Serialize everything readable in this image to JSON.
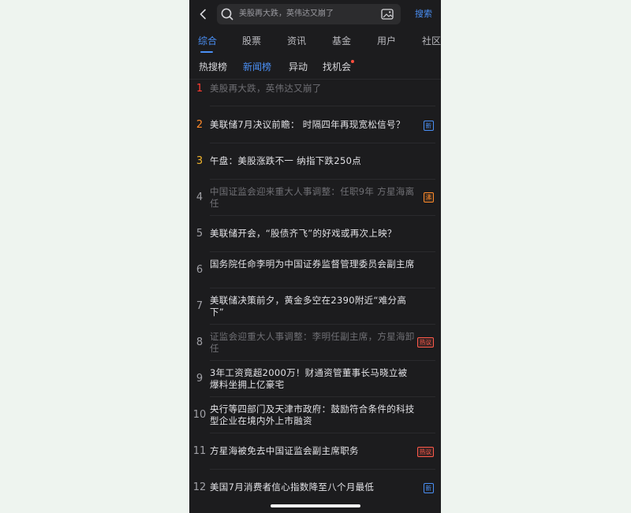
{
  "search": {
    "query": "美股再大跌，英伟达又崩了",
    "button_label": "搜索"
  },
  "icons": {
    "back": "chevron-left-icon",
    "search": "search-icon",
    "image_search": "image-search-icon"
  },
  "main_tabs": [
    {
      "label": "综合",
      "active": true
    },
    {
      "label": "股票",
      "active": false
    },
    {
      "label": "资讯",
      "active": false
    },
    {
      "label": "基金",
      "active": false
    },
    {
      "label": "用户",
      "active": false
    },
    {
      "label": "社区",
      "active": false
    }
  ],
  "sub_tabs": [
    {
      "label": "热搜榜",
      "active": false
    },
    {
      "label": "新闻榜",
      "active": true
    },
    {
      "label": "异动",
      "active": false
    },
    {
      "label": "找机会",
      "active": false,
      "dot": true
    }
  ],
  "colors": {
    "accent": "#4a8ff5",
    "rank1": "#ff3b30",
    "rank2": "#ff8a2a",
    "rank3": "#f2b52c",
    "badge_hot": "#ff5a4a",
    "badge_boil": "#ff8a2a",
    "background": "#1c1c1e"
  },
  "news": [
    {
      "rank": "1",
      "title": "美股再大跌，英伟达又崩了",
      "read": true,
      "badge": ""
    },
    {
      "rank": "2",
      "title": "美联储7月决议前瞻： 时隔四年再现宽松信号？",
      "read": false,
      "badge": "新"
    },
    {
      "rank": "3",
      "title": "午盘：美股涨跌不一 纳指下跌250点",
      "read": false,
      "badge": ""
    },
    {
      "rank": "4",
      "title": "中国证监会迎来重大人事调整：任职9年 方星海离任",
      "read": true,
      "badge": "沸"
    },
    {
      "rank": "5",
      "title": "美联储开会，“股债齐飞”的好戏或再次上映？",
      "read": false,
      "badge": ""
    },
    {
      "rank": "6",
      "title": "国务院任命李明为中国证券监督管理委员会副主席",
      "read": false,
      "badge": ""
    },
    {
      "rank": "7",
      "title": "美联储决策前夕，黄金多空在2390附近“难分高下”",
      "read": false,
      "badge": ""
    },
    {
      "rank": "8",
      "title": "证监会迎重大人事调整：李明任副主席，方星海卸任",
      "read": true,
      "badge": "热议"
    },
    {
      "rank": "9",
      "title": "3年工资竟超2000万！财通资管董事长马晓立被爆料坐拥上亿豪宅",
      "read": false,
      "badge": ""
    },
    {
      "rank": "10",
      "title": "央行等四部门及天津市政府：鼓励符合条件的科技型企业在境内外上市融资",
      "read": false,
      "badge": ""
    },
    {
      "rank": "11",
      "title": "方星海被免去中国证监会副主席职务",
      "read": false,
      "badge": "热议"
    },
    {
      "rank": "12",
      "title": "美国7月消费者信心指数降至八个月最低",
      "read": false,
      "badge": "新"
    }
  ]
}
